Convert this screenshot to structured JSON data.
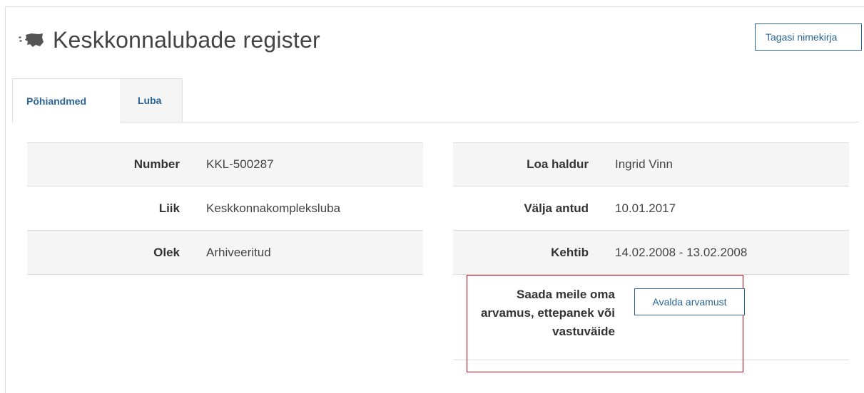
{
  "header": {
    "title": "Keskkonnalubade register",
    "logo_icon": "estonia-map-icon",
    "back_button_label": "Tagasi nimekirja"
  },
  "tabs": [
    {
      "label": "Põhiandmed",
      "active": true
    },
    {
      "label": "Luba",
      "active": false
    }
  ],
  "details_left": [
    {
      "label": "Number",
      "value": "KKL-500287"
    },
    {
      "label": "Liik",
      "value": "Keskkonnakompleksluba"
    },
    {
      "label": "Olek",
      "value": "Arhiveeritud"
    }
  ],
  "details_right": [
    {
      "label": "Loa haldur",
      "value": "Ingrid Vinn"
    },
    {
      "label": "Välja antud",
      "value": "10.01.2017"
    },
    {
      "label": "Kehtib",
      "value": "14.02.2008 - 13.02.2008"
    }
  ],
  "feedback": {
    "label": "Saada meile oma arvamus, ettepanek või vastuväide",
    "button_label": "Avalda arvamust"
  },
  "colors": {
    "link_blue": "#2a6496",
    "highlight_red": "#d0021b",
    "row_shade": "#f5f5f5",
    "border": "#dddddd"
  }
}
